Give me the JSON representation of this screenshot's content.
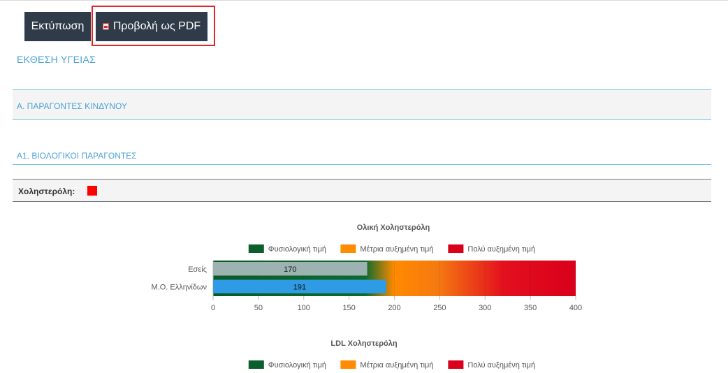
{
  "toolbar": {
    "print_label": "Εκτύπωση",
    "pdf_label": "Προβολή ως PDF"
  },
  "report": {
    "title": "ΕΚΘΕΣΗ ΥΓΕΙΑΣ",
    "section_a": "Α. ΠΑΡΑΓΟΝΤΕΣ ΚΙΝΔΥΝΟΥ",
    "section_a1": "Α1. ΒΙΟΛΟΓΙΚΟΙ ΠΑΡΑΓΟΝΤΕΣ",
    "cholesterol_label": "Χοληστερόλη:",
    "cholesterol_status_color": "#ff0000"
  },
  "chart_data": [
    {
      "type": "bar",
      "orientation": "horizontal",
      "title": "Ολική Χοληστερόλη",
      "legend": [
        {
          "label": "Φυσιολογική τιμή",
          "color": "#0b5f2c"
        },
        {
          "label": "Μέτρια αυξημένη τιμή",
          "color": "#ff8c00"
        },
        {
          "label": "Πολύ αυξημένη τιμή",
          "color": "#d9001b"
        }
      ],
      "legend_position": "top",
      "categories": [
        "Εσείς",
        "Μ.Ο. Ελληνίδων"
      ],
      "values": [
        170,
        191
      ],
      "bar_colors": [
        "#9db3b1",
        "#2f9be4"
      ],
      "background_range": [
        0,
        400
      ],
      "xlim": [
        0,
        400
      ],
      "xticks": [
        0,
        50,
        100,
        150,
        200,
        250,
        300,
        350,
        400
      ]
    },
    {
      "type": "bar",
      "orientation": "horizontal",
      "title": "LDL Χοληστερόλη",
      "legend": [
        {
          "label": "Φυσιολογική τιμή",
          "color": "#0b5f2c"
        },
        {
          "label": "Μέτρια αυξημένη τιμή",
          "color": "#ff8c00"
        },
        {
          "label": "Πολύ αυξημένη τιμή",
          "color": "#d9001b"
        }
      ],
      "legend_position": "top"
    }
  ]
}
